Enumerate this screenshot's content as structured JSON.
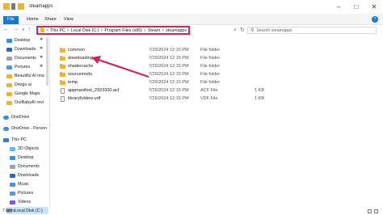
{
  "window": {
    "title": "steamapps",
    "minimize_icon": "minimize-icon",
    "maximize_icon": "maximize-icon",
    "close_icon": "close-icon"
  },
  "ribbon": {
    "tabs": [
      "File",
      "Home",
      "Share",
      "View"
    ],
    "help_label": "?"
  },
  "address": {
    "segments": [
      "This PC",
      "Local Disk (C:)",
      "Program Files (x86)",
      "Steam",
      "steamapps"
    ],
    "separator": ">",
    "search_placeholder": "Search steamapps"
  },
  "sidebar": {
    "items": [
      {
        "label": "Desktop",
        "icon": "desktop-icon",
        "pinned": true
      },
      {
        "label": "Downloads",
        "icon": "downloads-icon",
        "pinned": true
      },
      {
        "label": "Documents",
        "icon": "documents-icon",
        "pinned": true
      },
      {
        "label": "Pictures",
        "icon": "pictures-icon",
        "pinned": true
      },
      {
        "label": "Beautiful AI ima",
        "icon": "folder-icon"
      },
      {
        "label": "Dezgo ai",
        "icon": "folder-icon"
      },
      {
        "label": "Google Maps",
        "icon": "folder-icon"
      },
      {
        "label": "OurBabyAI revi",
        "icon": "folder-icon"
      },
      {
        "label": "OneDrive",
        "icon": "cloud-icon"
      },
      {
        "label": "OneDrive - Person",
        "icon": "cloud-icon"
      },
      {
        "label": "This PC",
        "icon": "computer-icon"
      },
      {
        "label": "3D Objects",
        "icon": "cube-icon"
      },
      {
        "label": "Desktop",
        "icon": "desktop-icon"
      },
      {
        "label": "Documents",
        "icon": "documents-icon"
      },
      {
        "label": "Downloads",
        "icon": "downloads-icon"
      },
      {
        "label": "Music",
        "icon": "music-icon"
      },
      {
        "label": "Pictures",
        "icon": "pictures-icon"
      },
      {
        "label": "Videos",
        "icon": "videos-icon"
      },
      {
        "label": "Local Disk (C:)",
        "icon": "drive-icon",
        "selected": true
      }
    ]
  },
  "files": [
    {
      "name": "common",
      "date": "7/29/2024 12:15 PM",
      "type": "File folder",
      "size": "",
      "icon": "folder-icon"
    },
    {
      "name": "downloading",
      "date": "7/29/2024 12:15 PM",
      "type": "File folder",
      "size": "",
      "icon": "folder-icon"
    },
    {
      "name": "shadercache",
      "date": "7/29/2024 12:15 PM",
      "type": "File folder",
      "size": "",
      "icon": "folder-icon"
    },
    {
      "name": "sourcemods",
      "date": "7/29/2024 12:15 PM",
      "type": "File folder",
      "size": "",
      "icon": "folder-icon"
    },
    {
      "name": "temp",
      "date": "7/29/2024 12:15 PM",
      "type": "File folder",
      "size": "",
      "icon": "folder-icon"
    },
    {
      "name": "appmanifest_2923300.acf",
      "date": "7/29/2024 12:15 PM",
      "type": "ACF File",
      "size": "1 KB",
      "icon": "file-icon"
    },
    {
      "name": "libraryfolders.vdf",
      "date": "7/29/2024 12:15 PM",
      "type": "VDF File",
      "size": "1 KB",
      "icon": "file-icon"
    }
  ],
  "status": {
    "count": "7 items"
  },
  "annotation": {
    "color": "#d6245a"
  }
}
